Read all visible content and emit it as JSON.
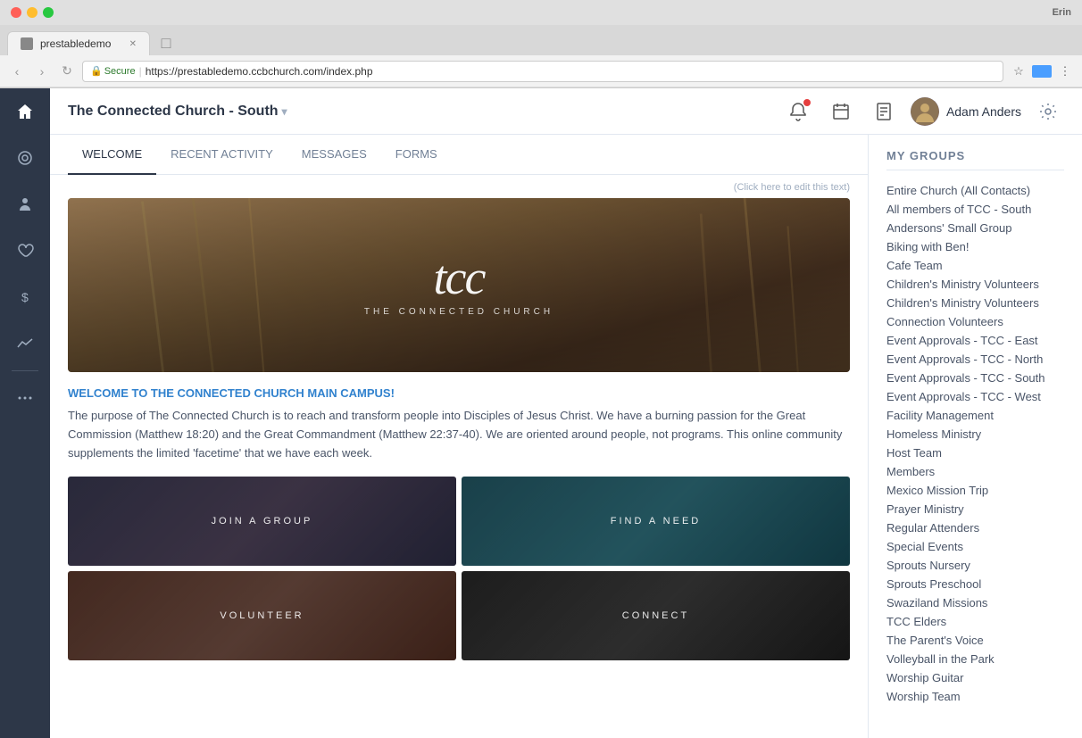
{
  "browser": {
    "tab_title": "prestabledemo",
    "url_secure": "Secure",
    "url_full": "https://prestabledemo.ccbchurch.com/index.php",
    "user_initials": "Erin"
  },
  "header": {
    "app_title": "The Connected Church - South",
    "user_name": "Adam Anders",
    "notification_icon": "🔔",
    "calendar_icon": "📅",
    "doc_icon": "📄",
    "settings_icon": "⚙"
  },
  "tabs": [
    {
      "id": "welcome",
      "label": "WELCOME",
      "active": true
    },
    {
      "id": "recent",
      "label": "RECENT ACTIVITY"
    },
    {
      "id": "messages",
      "label": "MESSAGES"
    },
    {
      "id": "forms",
      "label": "FORMS"
    }
  ],
  "welcome": {
    "edit_hint": "(Click here to edit this text)",
    "hero_logo": "tcc",
    "hero_subtitle": "THE CONNECTED CHURCH",
    "heading": "WELCOME TO THE CONNECTED CHURCH MAIN CAMPUS!",
    "body": "The purpose of The Connected Church is to reach and transform people into Disciples of Jesus Christ. We have a burning passion for the Great Commission (Matthew 18:20) and the Great Commandment (Matthew 22:37-40). We are oriented around people, not programs. This online community supplements the limited 'facetime' that we have each week.",
    "tiles": [
      {
        "id": "join",
        "label": "JOIN A GROUP"
      },
      {
        "id": "find",
        "label": "FIND A NEED"
      },
      {
        "id": "volunteer",
        "label": "VOLUNTEER"
      },
      {
        "id": "connect",
        "label": "CONNECT"
      }
    ]
  },
  "sidebar": {
    "items": [
      {
        "id": "home",
        "icon": "⌂",
        "active": true
      },
      {
        "id": "community",
        "icon": "◉"
      },
      {
        "id": "people",
        "icon": "👤"
      },
      {
        "id": "heart",
        "icon": "♡"
      },
      {
        "id": "dollar",
        "icon": "$"
      },
      {
        "id": "chart",
        "icon": "∿"
      },
      {
        "id": "more",
        "icon": "···"
      }
    ]
  },
  "my_groups": {
    "title": "MY GROUPS",
    "items": [
      "Entire Church (All Contacts)",
      "All members of TCC - South",
      "Andersons' Small Group",
      "Biking with Ben!",
      "Cafe Team",
      "Children's Ministry Volunteers",
      "Children's Ministry Volunteers",
      "Connection Volunteers",
      "Event Approvals - TCC - East",
      "Event Approvals - TCC - North",
      "Event Approvals - TCC - South",
      "Event Approvals - TCC - West",
      "Facility Management",
      "Homeless Ministry",
      "Host Team",
      "Members",
      "Mexico Mission Trip",
      "Prayer Ministry",
      "Regular Attenders",
      "Special Events",
      "Sprouts Nursery",
      "Sprouts Preschool",
      "Swaziland Missions",
      "TCC Elders",
      "The Parent's Voice",
      "Volleyball in the Park",
      "Worship Guitar",
      "Worship Team"
    ]
  }
}
